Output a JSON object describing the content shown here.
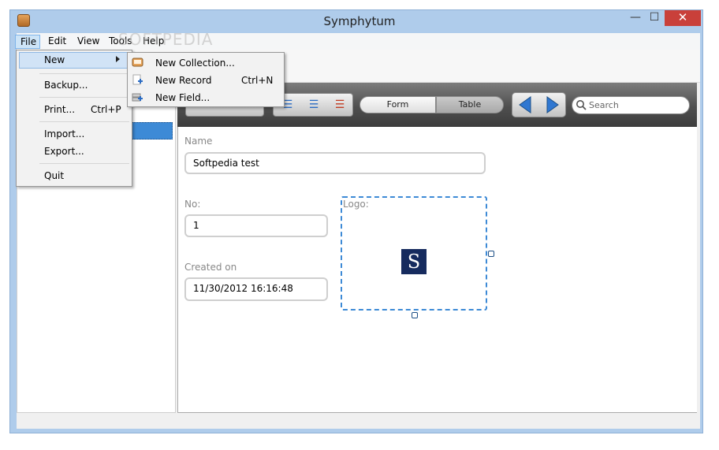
{
  "window": {
    "title": "Symphytum",
    "controls": {
      "minimize": "—",
      "maximize": "☐",
      "close": "✕"
    }
  },
  "menubar": {
    "items": [
      "File",
      "Edit",
      "View",
      "Tools",
      "Help"
    ],
    "watermark": "SOFTPEDIA"
  },
  "file_menu": {
    "new": "New",
    "backup": "Backup...",
    "print": "Print...",
    "print_shortcut": "Ctrl+P",
    "import": "Import...",
    "export": "Export...",
    "quit": "Quit"
  },
  "new_submenu": {
    "new_collection": "New Collection...",
    "new_record": "New Record",
    "new_record_shortcut": "Ctrl+N",
    "new_field": "New Field..."
  },
  "toolbar": {
    "view_form": "Form",
    "view_table": "Table",
    "search_placeholder": "Search"
  },
  "record": {
    "name_label": "Name",
    "name_value": "Softpedia test",
    "no_label": "No:",
    "no_value": "1",
    "created_label": "Created on",
    "created_value": "11/30/2012 16:16:48",
    "logo_label": "Logo:",
    "logo_letter": "S"
  },
  "colors": {
    "accent": "#3d8ad6",
    "close_button": "#c9403a",
    "logo_bg": "#162b5e"
  }
}
